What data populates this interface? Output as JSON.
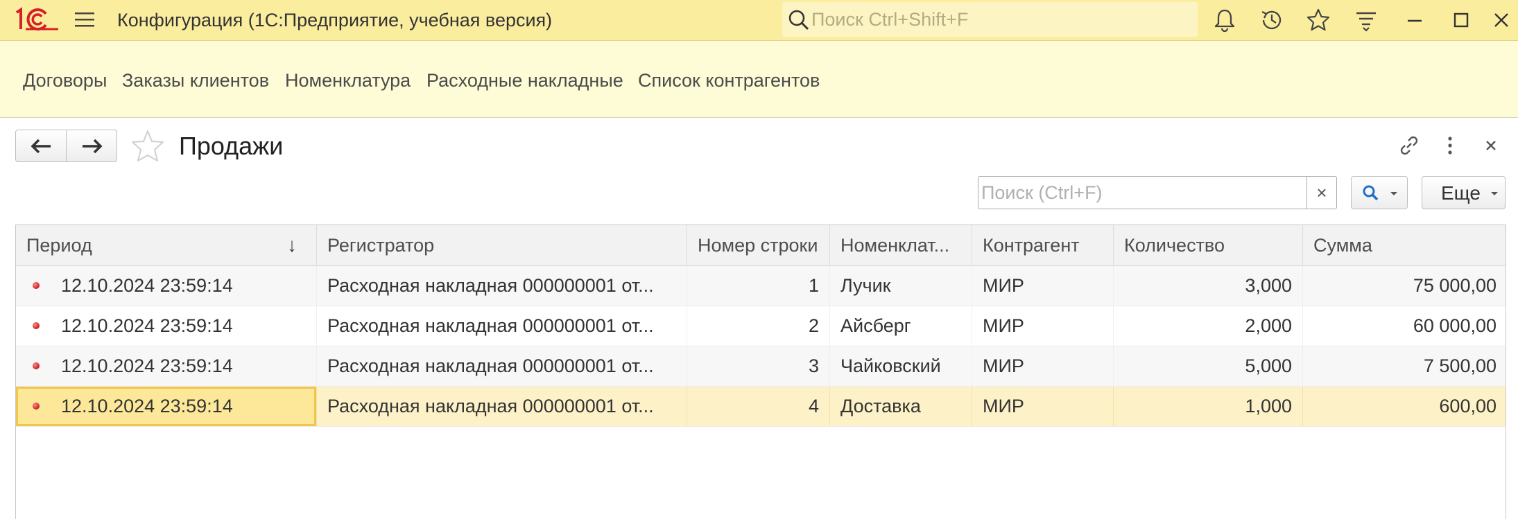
{
  "window": {
    "title": "Конфигурация  (1С:Предприятие, учебная версия)",
    "search_placeholder": "Поиск Ctrl+Shift+F"
  },
  "sections": [
    {
      "label": "Договоры"
    },
    {
      "label": "Заказы клиентов"
    },
    {
      "label": "Номенклатура"
    },
    {
      "label": "Расходные накладные"
    },
    {
      "label": "Список контрагентов"
    }
  ],
  "form": {
    "title": "Продажи",
    "search_placeholder": "Поиск (Ctrl+F)",
    "clear_label": "×",
    "more_label": "Еще"
  },
  "table": {
    "sort_indicator": "↓",
    "columns": [
      {
        "label": "Период"
      },
      {
        "label": "Регистратор"
      },
      {
        "label": "Номер строки"
      },
      {
        "label": "Номенклат..."
      },
      {
        "label": "Контрагент"
      },
      {
        "label": "Количество"
      },
      {
        "label": "Сумма"
      }
    ],
    "rows": [
      {
        "period": "12.10.2024 23:59:14",
        "registrar": "Расходная накладная 000000001 от...",
        "line": "1",
        "item": "Лучик",
        "counterparty": "МИР",
        "qty": "3,000",
        "sum": "75 000,00"
      },
      {
        "period": "12.10.2024 23:59:14",
        "registrar": "Расходная накладная 000000001 от...",
        "line": "2",
        "item": "Айсберг",
        "counterparty": "МИР",
        "qty": "2,000",
        "sum": "60 000,00"
      },
      {
        "period": "12.10.2024 23:59:14",
        "registrar": "Расходная накладная 000000001 от...",
        "line": "3",
        "item": "Чайковский",
        "counterparty": "МИР",
        "qty": "5,000",
        "sum": "7 500,00"
      },
      {
        "period": "12.10.2024 23:59:14",
        "registrar": "Расходная накладная 000000001 от...",
        "line": "4",
        "item": "Доставка",
        "counterparty": "МИР",
        "qty": "1,000",
        "sum": "600,00"
      }
    ]
  },
  "colors": {
    "titlebar": "#fbed9e",
    "sections_panel": "#fefcd6",
    "logo_red": "#d62027",
    "selected_row": "#fdf1c7",
    "selected_cell": "#fde89a",
    "search_icon_blue": "#1f6fc5"
  },
  "icons": [
    "1c-logo",
    "hamburger-menu-icon",
    "search-icon",
    "bell-icon",
    "history-icon",
    "star-icon",
    "filter-icon",
    "minimize-icon",
    "maximize-icon",
    "close-icon",
    "back-arrow-icon",
    "forward-arrow-icon",
    "favorite-star-icon",
    "link-icon",
    "more-vertical-icon",
    "close-form-icon",
    "status-dot-icon"
  ]
}
